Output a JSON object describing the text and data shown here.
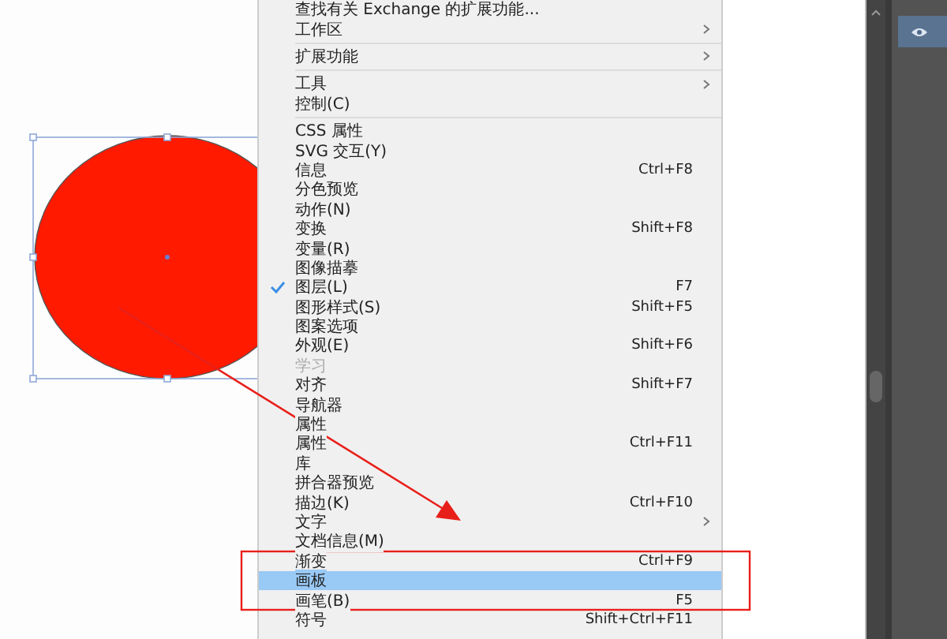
{
  "menu": {
    "items": [
      {
        "kind": "item",
        "label": "查找有关 Exchange 的扩展功能...",
        "submenu": false,
        "checked": false,
        "disabled": false,
        "selected": false
      },
      {
        "kind": "item",
        "label": "工作区",
        "submenu": true,
        "checked": false,
        "disabled": false,
        "selected": false
      },
      {
        "kind": "separator"
      },
      {
        "kind": "item",
        "label": "扩展功能",
        "submenu": true,
        "checked": false,
        "disabled": false,
        "selected": false
      },
      {
        "kind": "separator"
      },
      {
        "kind": "item",
        "label": "工具",
        "submenu": true,
        "checked": false,
        "disabled": false,
        "selected": false
      },
      {
        "kind": "item",
        "label": "控制(C)",
        "submenu": false,
        "checked": false,
        "disabled": false,
        "selected": false
      },
      {
        "kind": "separator"
      },
      {
        "kind": "item",
        "label": "CSS 属性",
        "submenu": false,
        "checked": false,
        "disabled": false,
        "selected": false
      },
      {
        "kind": "item",
        "label": "SVG 交互(Y)",
        "submenu": false,
        "checked": false,
        "disabled": false,
        "selected": false
      },
      {
        "kind": "item",
        "label": "信息",
        "shortcut": "Ctrl+F8",
        "submenu": false,
        "checked": false,
        "disabled": false,
        "selected": false
      },
      {
        "kind": "item",
        "label": "分色预览",
        "submenu": false,
        "checked": false,
        "disabled": false,
        "selected": false
      },
      {
        "kind": "item",
        "label": "动作(N)",
        "submenu": false,
        "checked": false,
        "disabled": false,
        "selected": false
      },
      {
        "kind": "item",
        "label": "变换",
        "shortcut": "Shift+F8",
        "submenu": false,
        "checked": false,
        "disabled": false,
        "selected": false
      },
      {
        "kind": "item",
        "label": "变量(R)",
        "submenu": false,
        "checked": false,
        "disabled": false,
        "selected": false
      },
      {
        "kind": "item",
        "label": "图像描摹",
        "submenu": false,
        "checked": false,
        "disabled": false,
        "selected": false
      },
      {
        "kind": "item",
        "label": "图层(L)",
        "shortcut": "F7",
        "submenu": false,
        "checked": true,
        "disabled": false,
        "selected": false
      },
      {
        "kind": "item",
        "label": "图形样式(S)",
        "shortcut": "Shift+F5",
        "submenu": false,
        "checked": false,
        "disabled": false,
        "selected": false
      },
      {
        "kind": "item",
        "label": "图案选项",
        "submenu": false,
        "checked": false,
        "disabled": false,
        "selected": false
      },
      {
        "kind": "item",
        "label": "外观(E)",
        "shortcut": "Shift+F6",
        "submenu": false,
        "checked": false,
        "disabled": false,
        "selected": false
      },
      {
        "kind": "item",
        "label": "学习",
        "submenu": false,
        "checked": false,
        "disabled": true,
        "selected": false
      },
      {
        "kind": "item",
        "label": "对齐",
        "shortcut": "Shift+F7",
        "submenu": false,
        "checked": false,
        "disabled": false,
        "selected": false
      },
      {
        "kind": "item",
        "label": "导航器",
        "submenu": false,
        "checked": false,
        "disabled": false,
        "selected": false
      },
      {
        "kind": "item",
        "label": "属性",
        "submenu": false,
        "checked": false,
        "disabled": false,
        "selected": false
      },
      {
        "kind": "item",
        "label": "属性",
        "shortcut": "Ctrl+F11",
        "submenu": false,
        "checked": false,
        "disabled": false,
        "selected": false
      },
      {
        "kind": "item",
        "label": "库",
        "submenu": false,
        "checked": false,
        "disabled": false,
        "selected": false
      },
      {
        "kind": "item",
        "label": "拼合器预览",
        "submenu": false,
        "checked": false,
        "disabled": false,
        "selected": false
      },
      {
        "kind": "item",
        "label": "描边(K)",
        "shortcut": "Ctrl+F10",
        "submenu": false,
        "checked": false,
        "disabled": false,
        "selected": false
      },
      {
        "kind": "item",
        "label": "文字",
        "submenu": true,
        "checked": false,
        "disabled": false,
        "selected": false
      },
      {
        "kind": "item",
        "label": "文档信息(M)",
        "submenu": false,
        "checked": false,
        "disabled": false,
        "selected": false
      },
      {
        "kind": "item",
        "label": "渐变",
        "shortcut": "Ctrl+F9",
        "submenu": false,
        "checked": false,
        "disabled": false,
        "selected": false
      },
      {
        "kind": "item",
        "label": "画板",
        "submenu": false,
        "checked": false,
        "disabled": false,
        "selected": true
      },
      {
        "kind": "item",
        "label": "画笔(B)",
        "shortcut": "F5",
        "submenu": false,
        "checked": false,
        "disabled": false,
        "selected": false
      },
      {
        "kind": "item",
        "label": "符号",
        "shortcut": "Shift+Ctrl+F11",
        "submenu": false,
        "checked": false,
        "disabled": false,
        "selected": false
      }
    ]
  }
}
